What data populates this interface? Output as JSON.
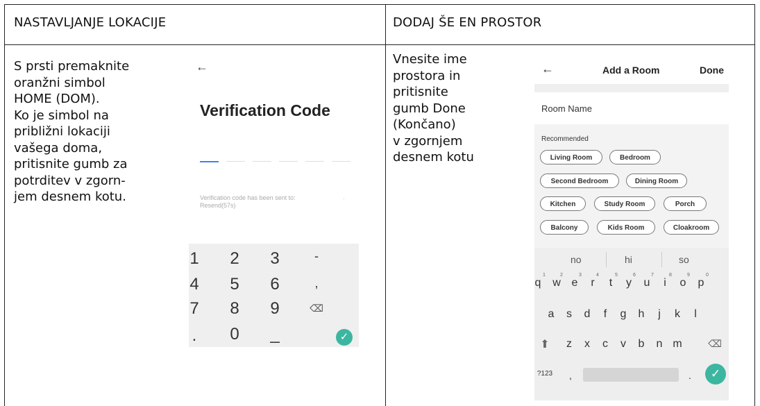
{
  "left": {
    "title": "NASTAVLJANJE LOKACIJE",
    "instruction": "S prsti premaknite\noranžni simbol\nHOME (DOM).\nKo je simbol na\npribližni lokaciji\nvašega doma,\npritisnite gumb za\npotrditev v zgorn-\njem desnem kotu."
  },
  "right": {
    "title": "DODAJ ŠE EN PROSTOR",
    "instruction": "Vnesite ime\nprostora in\npritisnite\ngumb Done\n(Končano)\nv zgornjem\ndesnem kotu"
  },
  "phone1": {
    "back": "←",
    "title": "Verification Code",
    "sent_text": "Verification code has been sent to:",
    "resend": "Resend(57s)",
    "dot": ".",
    "keys": [
      "1",
      "2",
      "3",
      "-",
      "4",
      "5",
      "6",
      ",",
      "7",
      "8",
      "9",
      "⌫",
      ".",
      "0",
      "_"
    ],
    "ok": "✓"
  },
  "phone2": {
    "back": "←",
    "title": "Add a Room",
    "done": "Done",
    "room_name_label": "Room Name",
    "recommended": "Recommended",
    "chips": [
      "Living Room",
      "Bedroom",
      "Second Bedroom",
      "Dining Room",
      "Kitchen",
      "Study Room",
      "Porch",
      "Balcony",
      "Kids Room",
      "Cloakroom"
    ],
    "suggestions": [
      "no",
      "hi",
      "so"
    ],
    "row1": [
      "q",
      "w",
      "e",
      "r",
      "t",
      "y",
      "u",
      "i",
      "o",
      "p"
    ],
    "row1_sup": [
      "1",
      "2",
      "3",
      "4",
      "5",
      "6",
      "7",
      "8",
      "9",
      "0"
    ],
    "row2": [
      "a",
      "s",
      "d",
      "f",
      "g",
      "h",
      "j",
      "k",
      "l"
    ],
    "row3": [
      "z",
      "x",
      "c",
      "v",
      "b",
      "n",
      "m"
    ],
    "shift": "⬆",
    "backspace": "⌫",
    "sym": "?123",
    "comma": ",",
    "period": ".",
    "ok": "✓"
  },
  "colors": {
    "accent": "#3cb6a0",
    "active_cell": "#3b82f6"
  }
}
